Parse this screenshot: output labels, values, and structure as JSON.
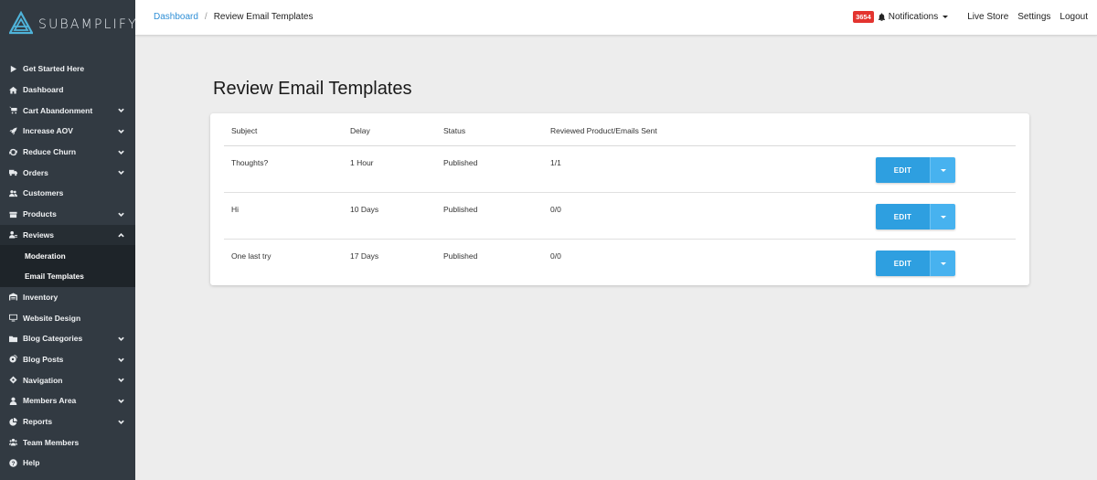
{
  "brand": {
    "name": "SUBAMPLIFY"
  },
  "sidebar": {
    "items": [
      {
        "label": "Get Started Here",
        "icon": "play-icon"
      },
      {
        "label": "Dashboard",
        "icon": "home-icon"
      },
      {
        "label": "Cart Abandonment",
        "icon": "cart-icon",
        "expandable": true
      },
      {
        "label": "Increase AOV",
        "icon": "rocket-icon",
        "expandable": true
      },
      {
        "label": "Reduce Churn",
        "icon": "sync-icon",
        "expandable": true
      },
      {
        "label": "Orders",
        "icon": "truck-icon",
        "expandable": true
      },
      {
        "label": "Customers",
        "icon": "users-icon"
      },
      {
        "label": "Products",
        "icon": "box-icon",
        "expandable": true
      },
      {
        "label": "Reviews",
        "icon": "review-user-icon",
        "expandable": true,
        "expanded": true
      },
      {
        "label": "Inventory",
        "icon": "warehouse-icon"
      },
      {
        "label": "Website Design",
        "icon": "monitor-icon"
      },
      {
        "label": "Blog Categories",
        "icon": "folder-icon",
        "expandable": true
      },
      {
        "label": "Blog Posts",
        "icon": "blog-icon",
        "expandable": true
      },
      {
        "label": "Navigation",
        "icon": "compass-icon",
        "expandable": true
      },
      {
        "label": "Members Area",
        "icon": "user-icon",
        "expandable": true
      },
      {
        "label": "Reports",
        "icon": "chart-pie-icon",
        "expandable": true
      },
      {
        "label": "Team Members",
        "icon": "team-icon"
      },
      {
        "label": "Help",
        "icon": "question-icon"
      }
    ],
    "reviews_sub": [
      "Moderation",
      "Email Templates"
    ]
  },
  "topbar": {
    "breadcrumb": {
      "parent": "Dashboard",
      "separator": "/",
      "current": "Review Email Templates"
    },
    "badge_count": "3654",
    "notifications": "Notifications",
    "live_store": "Live Store",
    "settings": "Settings",
    "logout": "Logout"
  },
  "main": {
    "title": "Review Email Templates",
    "table": {
      "headers": [
        "Subject",
        "Delay",
        "Status",
        "Reviewed Product/Emails Sent"
      ],
      "rows": [
        {
          "subject": "Thoughts?",
          "delay": "1 Hour",
          "status": "Published",
          "reviewed": "1/1",
          "action": "EDIT"
        },
        {
          "subject": "Hi",
          "delay": "10 Days",
          "status": "Published",
          "reviewed": "0/0",
          "action": "EDIT"
        },
        {
          "subject": "One last try",
          "delay": "17 Days",
          "status": "Published",
          "reviewed": "0/0",
          "action": "EDIT"
        }
      ]
    }
  },
  "colors": {
    "sidebar_bg": "#323a42",
    "accent": "#2e9fe0",
    "badge": "#e3342f",
    "link": "#2f8fd6"
  }
}
